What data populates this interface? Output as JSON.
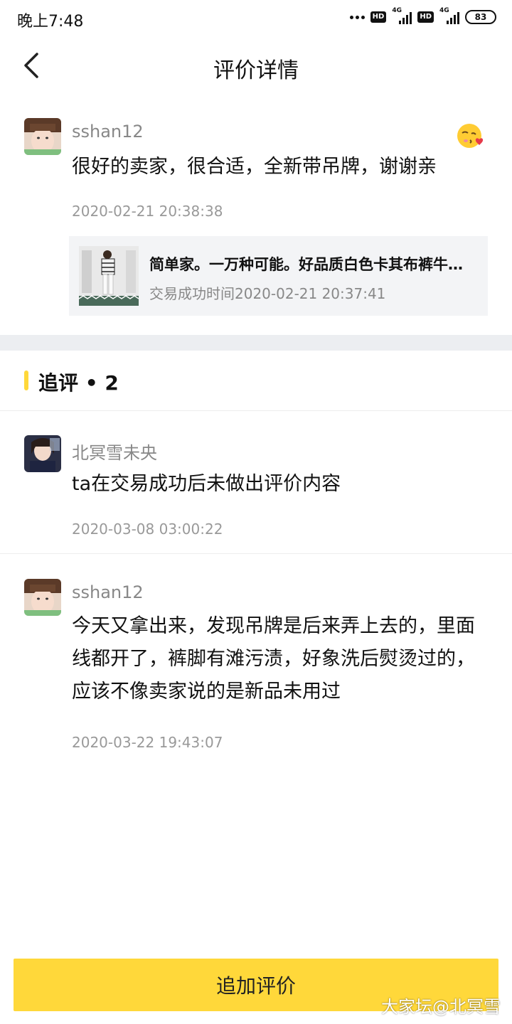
{
  "status_bar": {
    "time": "晚上7:48",
    "hd1": "HD",
    "net1": "4G",
    "hd2": "HD",
    "net2": "4G",
    "battery": "83"
  },
  "nav": {
    "title": "评价详情"
  },
  "main_review": {
    "username": "sshan12",
    "content": "很好的卖家，很合适，全新带吊牌，谢谢亲",
    "time": "2020-02-21 20:38:38",
    "emoji_icon": "kiss-emoji-icon",
    "product": {
      "title": "简单家。一万种可能。好品质白色卡其布裤牛仔裤",
      "subtitle": "交易成功时间2020-02-21 20:37:41"
    }
  },
  "followups": {
    "title": "追评 • 2",
    "items": [
      {
        "username": "北冥雪未央",
        "content": "ta在交易成功后未做出评价内容",
        "time": "2020-03-08 03:00:22"
      },
      {
        "username": "sshan12",
        "content": "今天又拿出来，发现吊牌是后来弄上去的，里面线都开了，裤脚有滩污渍，好象洗后熨烫过的，应该不像卖家说的是新品未用过",
        "time": "2020-03-22 19:43:07"
      }
    ]
  },
  "bottom": {
    "button_label": "追加评价"
  },
  "watermark": "大家坛@北冥雪",
  "colors": {
    "accent_yellow": "#ffd83a",
    "divider_band": "#eceef1",
    "card_bg": "#f3f4f6",
    "muted_text": "#888888"
  }
}
